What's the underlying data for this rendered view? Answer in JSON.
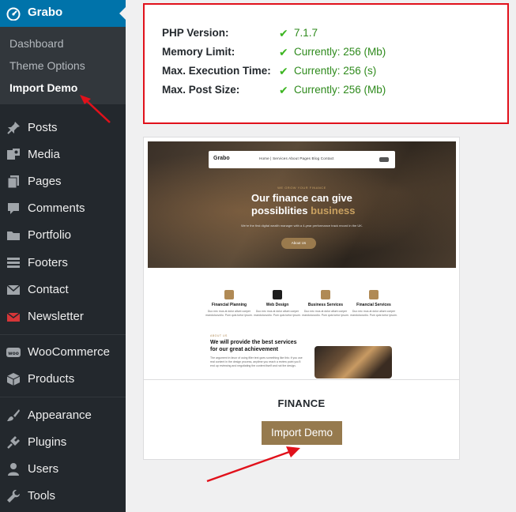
{
  "sidebar": {
    "brand": "Grabo",
    "submenu": [
      {
        "label": "Dashboard"
      },
      {
        "label": "Theme Options"
      },
      {
        "label": "Import Demo"
      }
    ],
    "items": [
      {
        "label": "Posts",
        "icon": "pushpin-icon"
      },
      {
        "label": "Media",
        "icon": "media-icon"
      },
      {
        "label": "Pages",
        "icon": "pages-icon"
      },
      {
        "label": "Comments",
        "icon": "comment-icon"
      },
      {
        "label": "Portfolio",
        "icon": "folder-icon"
      },
      {
        "label": "Footers",
        "icon": "footer-icon"
      },
      {
        "label": "Contact",
        "icon": "mail-icon"
      },
      {
        "label": "Newsletter",
        "icon": "newsletter-icon"
      },
      {
        "label": "WooCommerce",
        "icon": "woo-icon"
      },
      {
        "label": "Products",
        "icon": "box-icon"
      },
      {
        "label": "Appearance",
        "icon": "brush-icon"
      },
      {
        "label": "Plugins",
        "icon": "plug-icon"
      },
      {
        "label": "Users",
        "icon": "user-icon"
      },
      {
        "label": "Tools",
        "icon": "wrench-icon"
      }
    ]
  },
  "requirements": [
    {
      "name": "PHP Version:",
      "value": "7.1.7"
    },
    {
      "name": "Memory Limit:",
      "value": "Currently: 256 (Mb)"
    },
    {
      "name": "Max. Execution Time:",
      "value": "Currently: 256 (s)"
    },
    {
      "name": "Max. Post Size:",
      "value": "Currently: 256 (Mb)"
    }
  ],
  "demo": {
    "name": "FINANCE",
    "import_label": "Import Demo",
    "preview": {
      "nav_logo": "Grabo",
      "nav_links": "Home  |  Services   About   Pages   Blog   Contact",
      "eyebrow": "WE GROW YOUR FINANCE",
      "headline_line1": "Our finance can give",
      "headline_line2": "possiblities",
      "headline_accent": "business",
      "subtext": "We're the first digital wealth manager with a 4-year performance track record in the UK.",
      "cta": "About Us",
      "services": [
        {
          "title": "Financial Planning",
          "text": "Duo nec mus at dolor allunt coeper mandoloovolio. Pum quis tortor ipsum."
        },
        {
          "title": "Web Design",
          "text": "Duo nec mus at dolor allunt coeper mandoloovolio. Pum quis tortor ipsum."
        },
        {
          "title": "Business Services",
          "text": "Duo nec mus at dolor allunt coeper mandoloovolio. Pum quis tortor ipsum."
        },
        {
          "title": "Financial Services",
          "text": "Duo nec mus at dolor allunt coeper mandoloovolio. Pum quis tortor ipsum."
        }
      ],
      "about_eyebrow": "ABOUT US",
      "about_title": "We will provide the best services for our great achievement",
      "about_text": "The argument in favor of using filler text goes something like this: if you use real content in the design process, anytime you reach a review point you'll end up reviewing and negotiating the content itself and not the design."
    }
  },
  "colors": {
    "sidebar_bg": "#23282d",
    "brand_bg": "#0073aa",
    "highlight_red": "#e1111b",
    "check_green": "#3cb521",
    "button_brown": "#967a4e"
  }
}
